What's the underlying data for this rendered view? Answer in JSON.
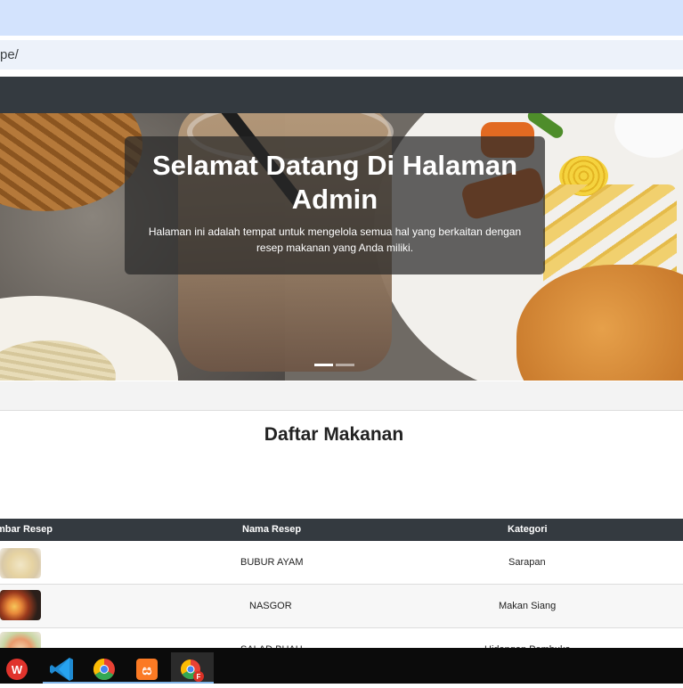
{
  "browser": {
    "address_text": "pe/"
  },
  "hero": {
    "title": "Selamat Datang Di Halaman Admin",
    "description": "Halaman ini adalah tempat untuk mengelola semua hal yang berkaitan dengan resep makanan yang Anda miliki."
  },
  "section": {
    "title": "Daftar Makanan"
  },
  "table": {
    "headers": [
      "mbar Resep",
      "Nama Resep",
      "Kategori"
    ],
    "rows": [
      {
        "name": "BUBUR AYAM",
        "category": "Sarapan"
      },
      {
        "name": "NASGOR",
        "category": "Makan Siang"
      },
      {
        "name": "SALAD BUAH",
        "category": "Hidangan Pembuka"
      }
    ]
  },
  "taskbar": {
    "icons": [
      "wps-office-icon",
      "vscode-icon",
      "chrome-icon",
      "xampp-icon",
      "chrome-profile-icon"
    ]
  },
  "colors": {
    "navbar": "#343a40",
    "tabbar": "#d3e3fd",
    "table_header": "#343a40"
  }
}
